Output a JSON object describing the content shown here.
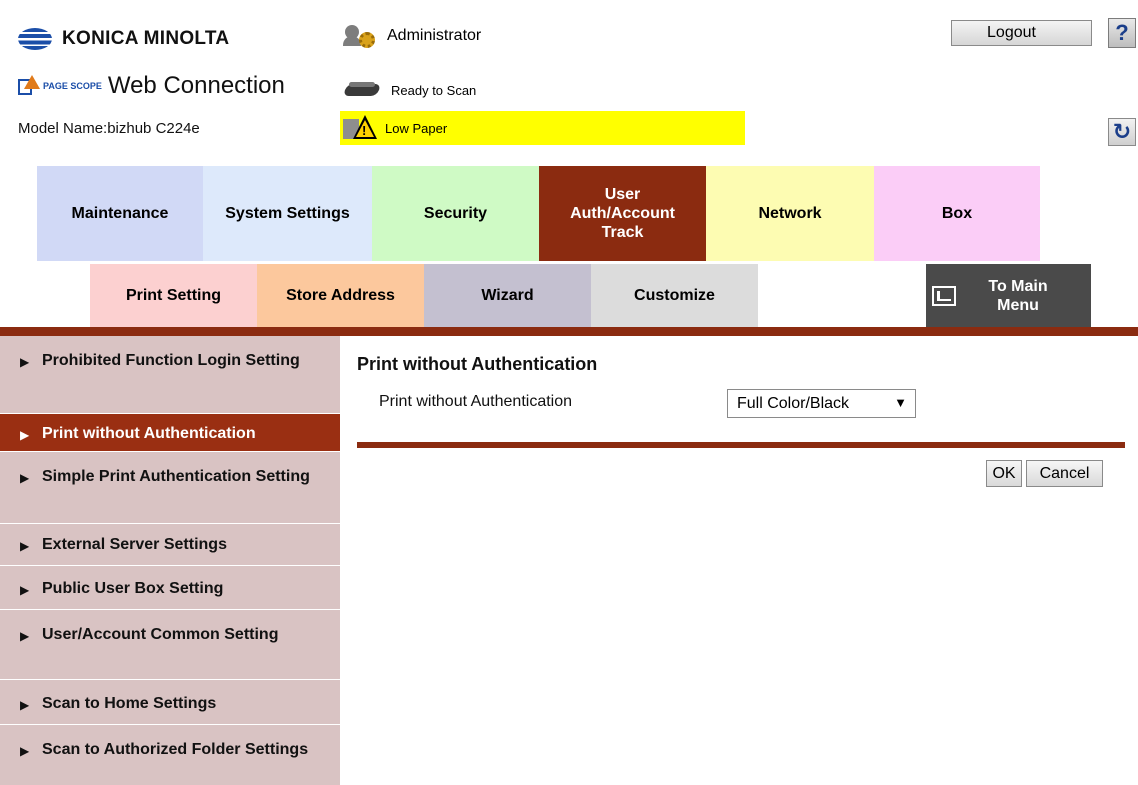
{
  "header": {
    "brand": "KONICA MINOLTA",
    "pagescope_label": "PAGE SCOPE",
    "app_title": "Web Connection",
    "model_name": "Model Name:bizhub C224e",
    "user": "Administrator",
    "status": "Ready to Scan",
    "alert": "Low Paper",
    "logout_label": "Logout",
    "help_label": "?",
    "refresh_label": "↻"
  },
  "tabs_row1": [
    {
      "label": "Maintenance",
      "color": "#d1d9f6"
    },
    {
      "label": "System Settings",
      "color": "#dde9fb"
    },
    {
      "label": "Security",
      "color": "#cffac5"
    },
    {
      "label": "User Auth/Account Track",
      "color": "#8b2b10",
      "active": true
    },
    {
      "label": "Network",
      "color": "#fdfcb2"
    },
    {
      "label": "Box",
      "color": "#fbcdf7"
    }
  ],
  "tabs_row2": [
    {
      "label": "Print Setting",
      "color": "#fcd0d0"
    },
    {
      "label": "Store Address",
      "color": "#fcc89d"
    },
    {
      "label": "Wizard",
      "color": "#c4c0d0"
    },
    {
      "label": "Customize",
      "color": "#dcdcdc"
    },
    {
      "label": "To Main Menu",
      "color": "#4a4a4a"
    }
  ],
  "sidebar": [
    {
      "label": "Prohibited Function Login Setting"
    },
    {
      "label": "Print without Authentication",
      "active": true
    },
    {
      "label": "Simple Print Authentication Setting"
    },
    {
      "label": "External Server Settings"
    },
    {
      "label": "Public User Box Setting"
    },
    {
      "label": "User/Account Common Setting"
    },
    {
      "label": "Scan to Home Settings"
    },
    {
      "label": "Scan to Authorized Folder Settings"
    }
  ],
  "content": {
    "title": "Print without Authentication",
    "field_label": "Print without Authentication",
    "select_value": "Full Color/Black",
    "ok_label": "OK",
    "cancel_label": "Cancel"
  },
  "colors": {
    "accent": "#8b2b10",
    "sidebar_bg": "#d9c3c3",
    "alert_bg": "#ffff00"
  }
}
